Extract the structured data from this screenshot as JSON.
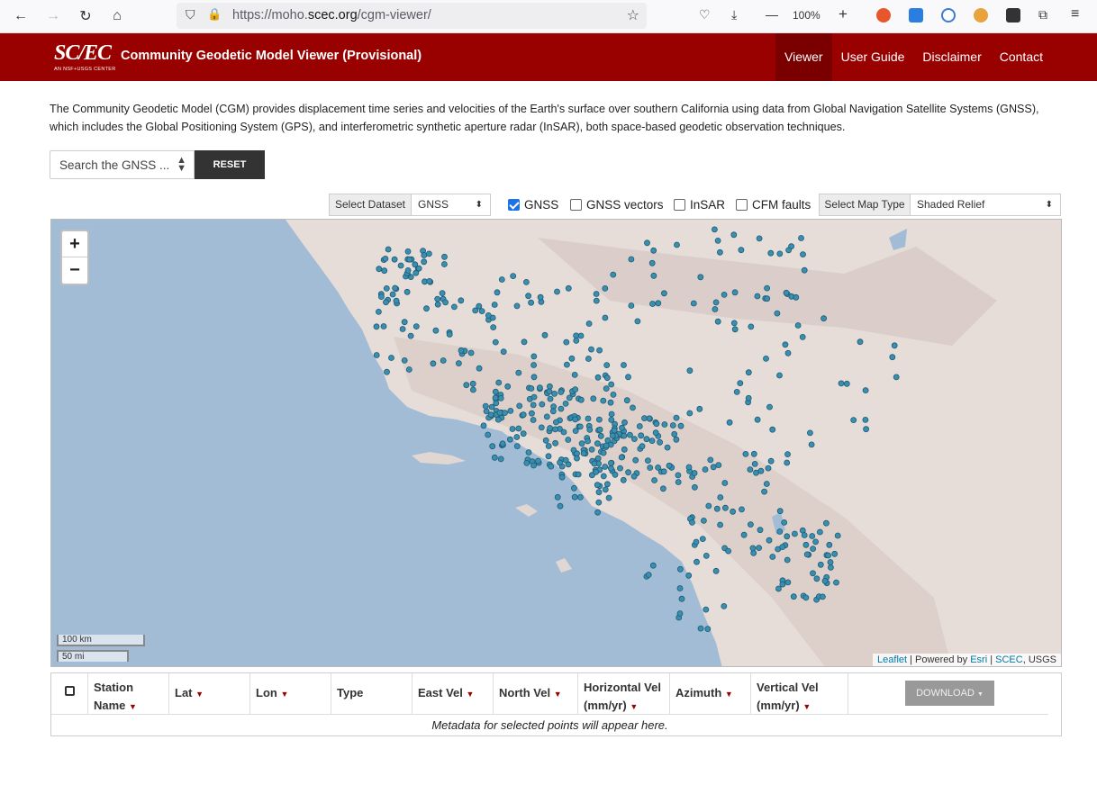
{
  "browser": {
    "url_prefix": "https://moho.",
    "url_domain": "scec.org",
    "url_path": "/cgm-viewer/",
    "zoom": "100%"
  },
  "header": {
    "logo_text": "SC/EC",
    "logo_sub": "AN NSF+USGS CENTER",
    "title": "Community Geodetic Model Viewer (Provisional)",
    "nav": [
      "Viewer",
      "User Guide",
      "Disclaimer",
      "Contact"
    ],
    "bg_color": "#990000"
  },
  "intro": "The Community Geodetic Model (CGM) provides displacement time series and velocities of the Earth's surface over southern California using data from Global Navigation Satellite Systems (GNSS), which includes the Global Positioning System (GPS), and interferometric synthetic aperture radar (InSAR), both space-based geodetic observation techniques.",
  "search": {
    "placeholder": "Search the GNSS ...",
    "reset_label": "RESET"
  },
  "controls": {
    "dataset_label": "Select Dataset",
    "dataset_value": "GNSS",
    "checkboxes": [
      {
        "label": "GNSS",
        "checked": true
      },
      {
        "label": "GNSS vectors",
        "checked": false
      },
      {
        "label": "InSAR",
        "checked": false
      },
      {
        "label": "CFM faults",
        "checked": false
      }
    ],
    "maptype_label": "Select Map Type",
    "maptype_value": "Shaded Relief"
  },
  "map": {
    "zoom_in": "+",
    "zoom_out": "−",
    "scale_km": "100 km",
    "scale_mi": "50 mi",
    "attribution": {
      "leaflet": "Leaflet",
      "powered": " | Powered by ",
      "esri": "Esri",
      "sep": " | ",
      "scec": "SCEC",
      "usgs": ", USGS"
    },
    "station_color": "#3a8fb0"
  },
  "table": {
    "columns": [
      "Station Name",
      "Lat",
      "Lon",
      "Type",
      "East Vel",
      "North Vel",
      "Horizontal Vel (mm/yr)",
      "Azimuth",
      "Vertical Vel (mm/yr)"
    ],
    "download_label": "DOWNLOAD",
    "empty_message": "Metadata for selected points will appear here."
  }
}
